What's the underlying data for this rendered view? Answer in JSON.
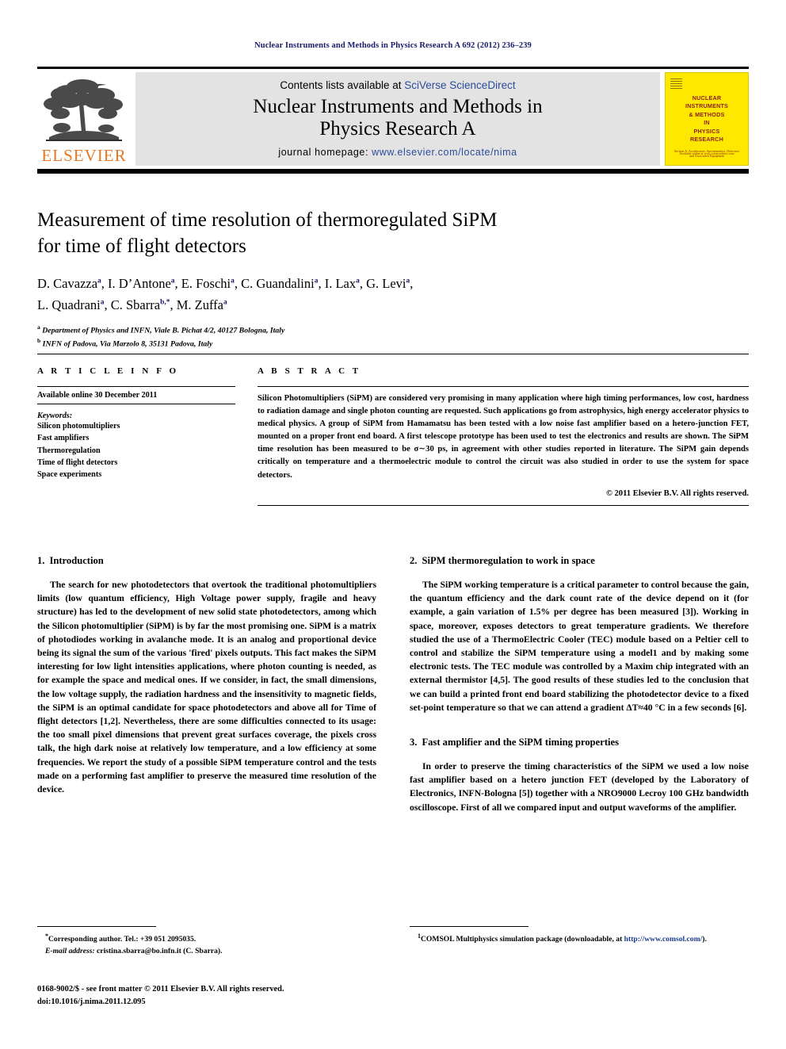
{
  "running_head": "Nuclear Instruments and Methods in Physics Research A 692 (2012) 236–239",
  "masthead": {
    "publisher_name": "ELSEVIER",
    "contents_prefix": "Contents lists available at ",
    "contents_link": "SciVerse ScienceDirect",
    "journal_title_line1": "Nuclear Instruments and Methods in",
    "journal_title_line2": "Physics Research A",
    "homepage_prefix": "journal homepage: ",
    "homepage_url": "www.elsevier.com/locate/nima",
    "cover": {
      "title_line1": "NUCLEAR",
      "title_line2": "INSTRUMENTS",
      "title_line3": "& METHODS",
      "title_line4": "IN",
      "title_line5": "PHYSICS",
      "title_line6": "RESEARCH",
      "subtitle": "Section A: Accelerators, Spectrometers, Detectors and Associated Equipment",
      "footer": "Available online at www.sciencedirect.com"
    },
    "accent_orange": "#E87722",
    "cover_yellow": "#FFE800",
    "link_blue": "#2b4c9b"
  },
  "title_block": {
    "title_line1": "Measurement of time resolution of thermoregulated SiPM",
    "title_line2": "for time of flight detectors",
    "authors_line1": "D. Cavazza a, I. D'Antone a, E. Foschi a, C. Guandalini a, I. Lax a, G. Levi a,",
    "authors_line2": "L. Quadrani a, C. Sbarra b,*, M. Zuffa a",
    "affiliation_a": "Department of Physics and INFN, Viale B. Pichat 4/2, 40127 Bologna, Italy",
    "affiliation_b": "INFN of Padova, Via Marzolo 8, 35131 Padova, Italy",
    "affil_marker_a": "a",
    "affil_marker_b": "b"
  },
  "article_info": {
    "heading": "A R T I C L E  I N F O",
    "history": "Available online 30 December 2011",
    "keywords_label": "Keywords:",
    "keywords": [
      "Silicon photomultipliers",
      "Fast amplifiers",
      "Thermoregulation",
      "Time of flight detectors",
      "Space experiments"
    ]
  },
  "abstract": {
    "heading": "A B S T R A C T",
    "text": "Silicon Photomultipliers (SiPM) are considered very promising in many application where high timing performances, low cost, hardness to radiation damage and single photon counting are requested. Such applications go from astrophysics, high energy accelerator physics to medical physics. A group of SiPM from Hamamatsu has been tested with a low noise fast amplifier based on a hetero-junction FET, mounted on a proper front end board. A first telescope prototype has been used to test the electronics and results are shown. The SiPM time resolution has been measured to be σ∼30 ps, in agreement with other studies reported in literature. The SiPM gain depends critically on temperature and a thermoelectric module to control the circuit was also studied in order to use the system for space detectors.",
    "copyright": "© 2011 Elsevier B.V. All rights reserved."
  },
  "sections": [
    {
      "number": "1.",
      "title": "Introduction",
      "paragraphs": [
        "The search for new photodetectors that overtook the traditional photomultipliers limits (low quantum efficiency, High Voltage power supply, fragile and heavy structure) has led to the development of new solid state photodetectors, among which the Silicon photomultiplier (SiPM) is by far the most promising one. SiPM is a matrix of photodiodes working in avalanche mode. It is an analog and proportional device being its signal the sum of the various 'fired' pixels outputs. This fact makes the SiPM interesting for low light intensities applications, where photon counting is needed, as for example the space and medical ones. If we consider, in fact, the small dimensions, the low voltage supply, the radiation hardness and the insensitivity to magnetic fields, the SiPM is an optimal candidate for space photodetectors and above all for Time of flight detectors [1,2]. Nevertheless, there are some difficulties connected to its usage: the too small pixel dimensions that prevent great surfaces coverage, the pixels cross talk, the high dark noise at relatively low temperature, and a low efficiency at some frequencies. We report the study of a possible SiPM temperature control and the tests made on a performing fast amplifier to preserve the measured time resolution of the device."
      ]
    },
    {
      "number": "2.",
      "title": "SiPM thermoregulation to work in space",
      "paragraphs": [
        "The SiPM working temperature is a critical parameter to control because the gain, the quantum efficiency and the dark count rate of the device depend on it (for example, a gain variation of 1.5% per degree has been measured [3]). Working in space, moreover, exposes detectors to great temperature gradients. We therefore studied the use of a ThermoElectric Cooler (TEC) module based on a Peltier cell to control and stabilize the SiPM temperature using a model1 and by making some electronic tests. The TEC module was controlled by a Maxim chip integrated with an external thermistor [4,5]. The good results of these studies led to the conclusion that we can build a printed front end board stabilizing the photodetector device to a fixed set-point temperature so that we can attend a gradient ΔT≈40 °C in a few seconds [6]."
      ]
    },
    {
      "number": "3.",
      "title": "Fast amplifier and the SiPM timing properties",
      "paragraphs": [
        "In order to preserve the timing characteristics of the SiPM we used a low noise fast amplifier based on a hetero junction FET (developed by the Laboratory of Electronics, INFN-Bologna [5]) together with a NRO9000 Lecroy 100 GHz bandwidth oscilloscope. First of all we compared input and output waveforms of the amplifier."
      ]
    }
  ],
  "footnotes": {
    "corresponding_marker": "*",
    "corresponding": "Corresponding author. Tel.: +39 051 2095035.",
    "email_label": "E-mail address:",
    "email": "cristina.sbarra@bo.infn.it (C. Sbarra).",
    "note_marker": "1",
    "note_text_pre": "COMSOL Multiphysics simulation package (downloadable, at ",
    "note_link": "http://www.comsol.com/",
    "note_text_post": ")."
  },
  "imprint": {
    "issn_line": "0168-9002/$ - see front matter © 2011 Elsevier B.V. All rights reserved.",
    "doi_line": "doi:10.1016/j.nima.2011.12.095"
  }
}
